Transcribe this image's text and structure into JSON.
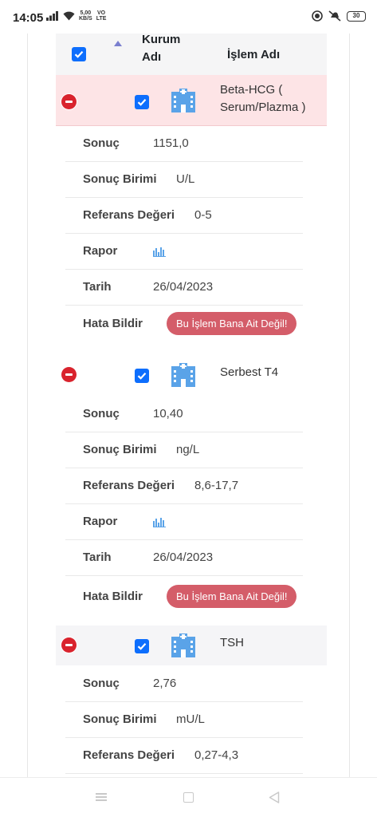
{
  "status_bar": {
    "time": "14:05",
    "net_speed_value": "5,00",
    "net_speed_unit": "KB/S",
    "network_label_top": "VO",
    "network_label_bottom": "LTE",
    "battery": "30"
  },
  "table": {
    "headers": {
      "kurum_line1": "Kurum",
      "kurum_line2": "Adı",
      "islem": "İşlem Adı"
    },
    "row_labels": {
      "result": "Sonuç",
      "unit": "Sonuç Birimi",
      "reference": "Referans Değeri",
      "report": "Rapor",
      "date": "Tarih",
      "error": "Hata Bildir"
    },
    "error_button_label": "Bu İşlem Bana Ait Değil!",
    "rows": [
      {
        "islem_name": "Beta-HCG ( Serum/Plazma )",
        "result": "1151,0",
        "unit": "U/L",
        "reference": "0-5",
        "date": "26/04/2023",
        "checked": true,
        "highlight": "danger"
      },
      {
        "islem_name": "Serbest T4",
        "result": "10,40",
        "unit": "ng/L",
        "reference": "8,6-17,7",
        "date": "26/04/2023",
        "checked": true,
        "highlight": "none"
      },
      {
        "islem_name": "TSH",
        "result": "2,76",
        "unit": "mU/L",
        "reference": "0,27-4,3",
        "checked": true,
        "highlight": "striped"
      }
    ]
  },
  "icons": {
    "row_remove": "minus-circle-icon",
    "institution": "hospital-icon",
    "report": "bar-chart-icon",
    "sort": "sort-asc-icon"
  },
  "colors": {
    "checkbox": "#0d6efd",
    "remove_button": "#d9232d",
    "error_button": "#d45d69",
    "danger_row": "#fde4e6",
    "icon_blue": "#5aa3e8"
  }
}
